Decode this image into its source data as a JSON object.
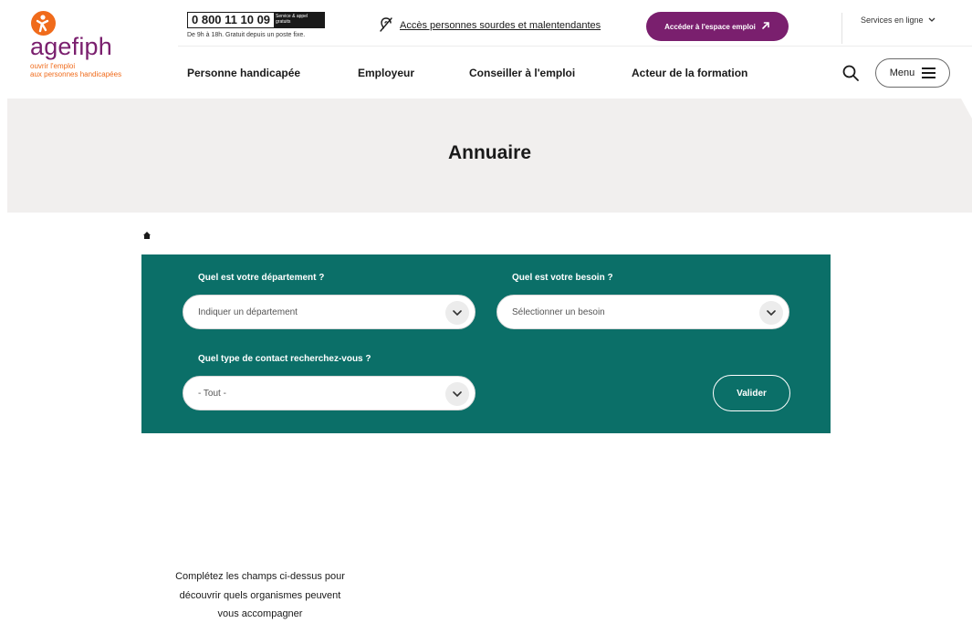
{
  "header": {
    "logo": {
      "wordmark": "agefiph",
      "tagline_line1": "ouvrir l'emploi",
      "tagline_line2": "aux personnes handicapées",
      "brand_color": "#7a1f6e",
      "accent_color": "#f06b1b"
    },
    "phone": {
      "number": "0 800 11 10 09",
      "badge_line1": "Service & appel",
      "badge_line2": "gratuits",
      "hours": "De 9h à 18h. Gratuit depuis un poste fixe."
    },
    "accessibility_link": "Accès personnes sourdes et malentendantes",
    "espace_emploi_button": "Accéder à l'espace emploi",
    "services_label": "Services en ligne",
    "nav": [
      "Personne handicapée",
      "Employeur",
      "Conseiller à l'emploi",
      "Acteur de la formation"
    ],
    "menu_label": "Menu"
  },
  "banner": {
    "title": "Annuaire"
  },
  "form": {
    "panel_color": "#0b6f68",
    "department": {
      "label": "Quel est votre département ?",
      "placeholder": "Indiquer un département"
    },
    "need": {
      "label": "Quel est votre besoin ?",
      "placeholder": "Sélectionner un besoin"
    },
    "contact_type": {
      "label": "Quel type de contact recherchez-vous ?",
      "value": "- Tout -"
    },
    "submit_label": "Valider"
  },
  "helper": {
    "line1": "Complétez les champs ci-dessus pour",
    "line2": "découvrir quels organismes peuvent",
    "line3": "vous accompagner"
  }
}
